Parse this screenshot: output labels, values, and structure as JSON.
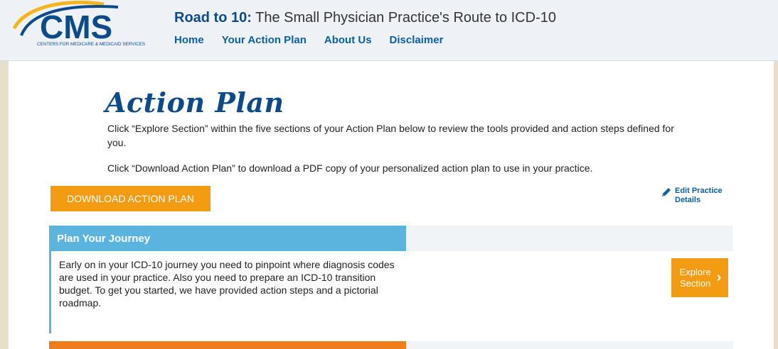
{
  "header": {
    "logo_text": "CMS",
    "logo_subtext": "CENTERS FOR MEDICARE & MEDICAID SERVICES",
    "title_strong": "Road to 10:",
    "title_rest": " The Small Physician Practice's Route to ICD-10",
    "nav": [
      "Home",
      "Your Action Plan",
      "About Us",
      "Disclaimer"
    ]
  },
  "main": {
    "heading": "Action Plan",
    "intro_1": "Click “Explore Section” within the five sections of your Action Plan below to review the tools provided and action steps defined for you.",
    "intro_2": "Click “Download Action Plan” to download a PDF copy of your personalized action plan to use in your practice.",
    "download_label": "DOWNLOAD ACTION PLAN",
    "edit_line1": "Edit Practice",
    "edit_line2": "Details"
  },
  "sections": [
    {
      "title": "Plan Your Journey",
      "description": "Early on in your ICD-10 journey you need to pinpoint where diagnosis codes are used in your practice. Also you need to prepare an ICD-10 transition budget. To get you started, we have provided action steps and a pictorial roadmap.",
      "explore_label": "Explore Section"
    }
  ],
  "colors": {
    "brand_blue": "#0b4a8b",
    "nav_blue": "#0b5fa0",
    "orange": "#f39b12",
    "section_blue": "#5ab4de",
    "next_section_orange": "#ef7d1c"
  }
}
